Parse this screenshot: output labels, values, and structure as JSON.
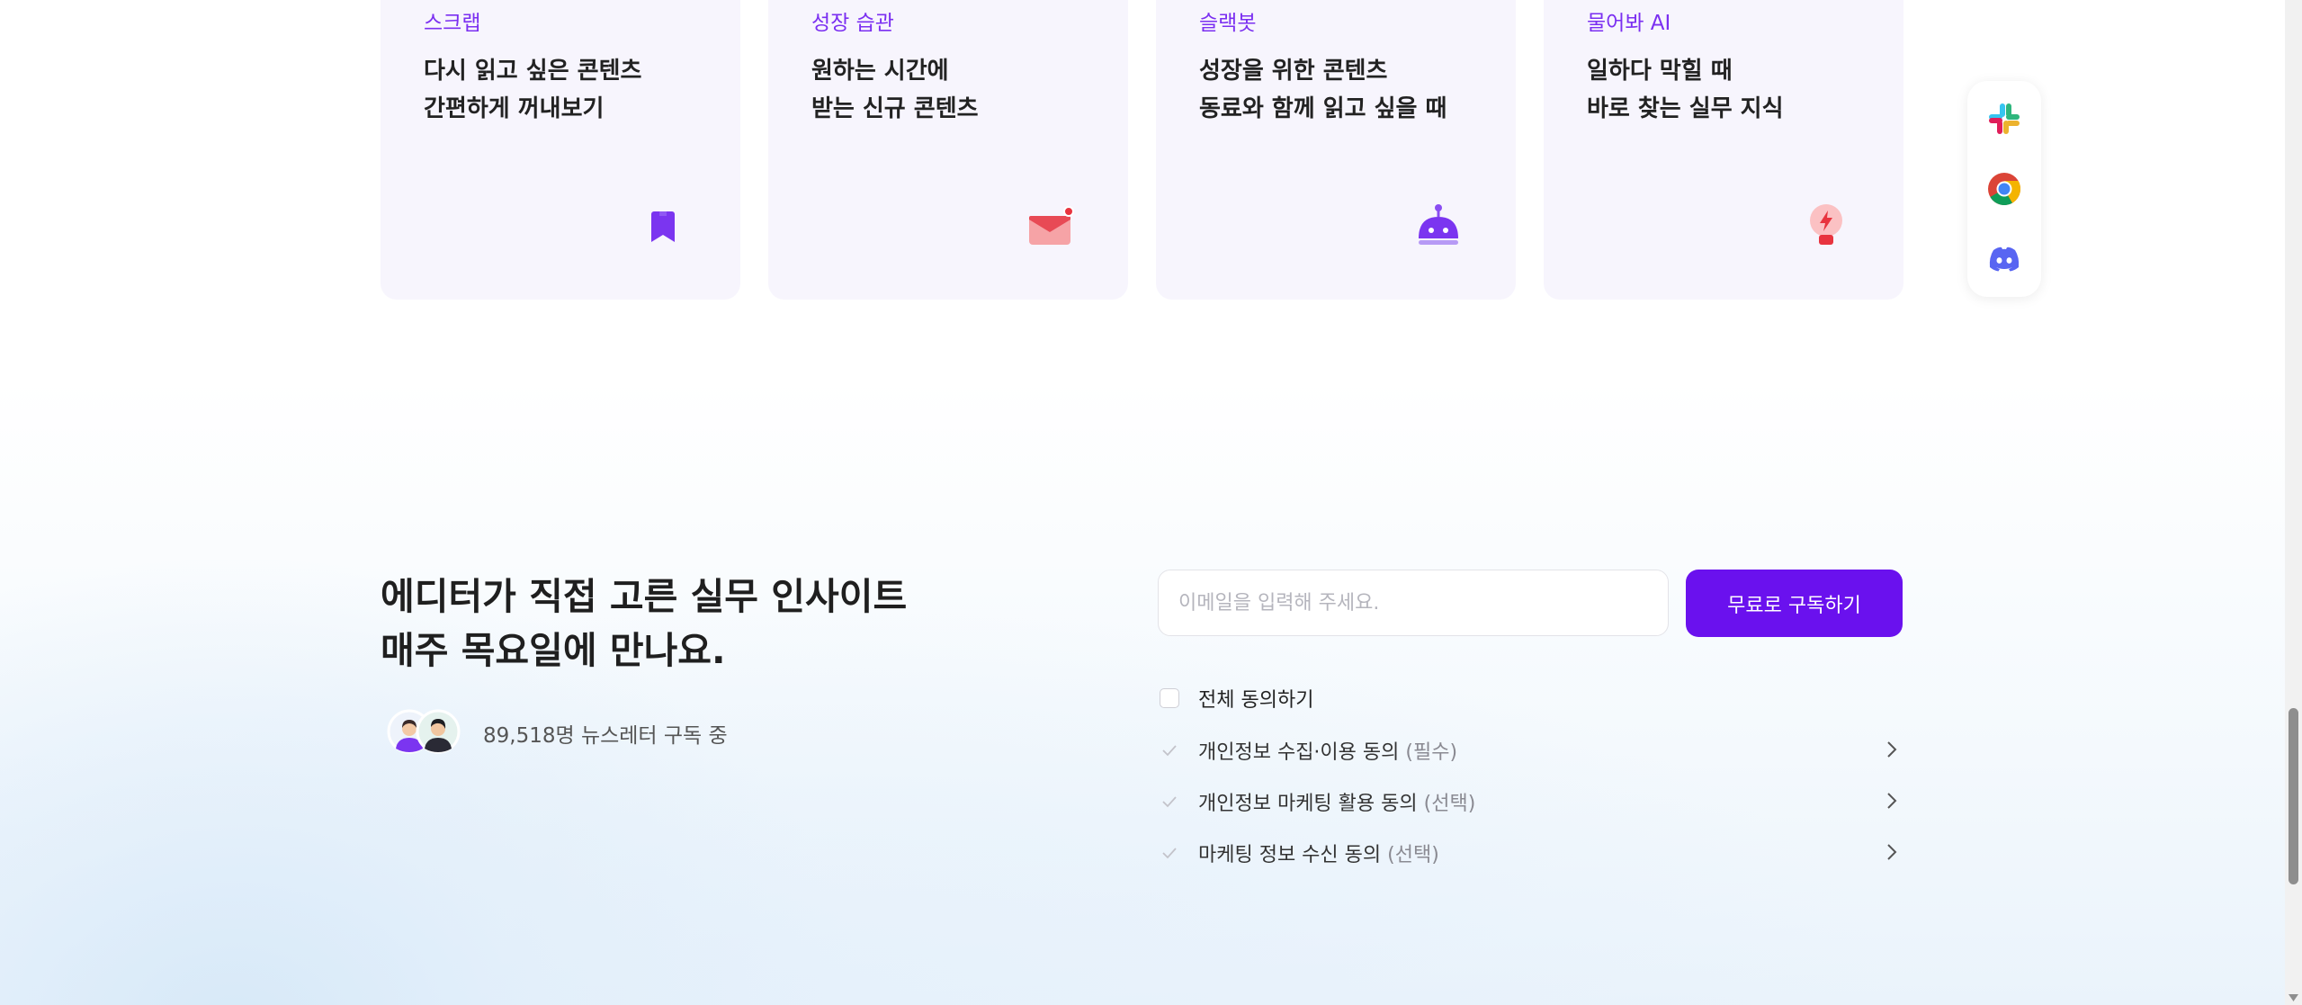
{
  "cards": [
    {
      "tag": "스크랩",
      "title": "다시 읽고 싶은 콘텐츠\n간편하게 꺼내보기",
      "icon": "bookmark-icon"
    },
    {
      "tag": "성장 습관",
      "title": "원하는 시간에\n받는 신규 콘텐츠",
      "icon": "mail-icon"
    },
    {
      "tag": "슬랙봇",
      "title": "성장을 위한 콘텐츠\n동료와 함께 읽고 싶을 때",
      "icon": "robot-icon"
    },
    {
      "tag": "물어봐 AI",
      "title": "일하다 막힐 때\n바로 찾는 실무 지식",
      "icon": "lightbulb-icon"
    }
  ],
  "app_rail": {
    "icons": [
      "slack-icon",
      "chrome-icon",
      "discord-icon"
    ]
  },
  "subscribe": {
    "headline": "에디터가 직접 고른 실무 인사이트\n매주 목요일에 만나요.",
    "subscriber_count": "89,518명 뉴스레터 구독 중",
    "email_placeholder": "이메일을 입력해 주세요.",
    "button_label": "무료로 구독하기",
    "agree_all_label": "전체 동의하기",
    "consents": [
      {
        "label": "개인정보 수집·이용 동의",
        "tag": "(필수)"
      },
      {
        "label": "개인정보 마케팅 활용 동의",
        "tag": "(선택)"
      },
      {
        "label": "마케팅 정보 수신 동의",
        "tag": "(선택)"
      }
    ]
  },
  "colors": {
    "accent": "#6a11ee",
    "tag_text": "#7b2ff1",
    "card_bg": "#f7f5fd"
  }
}
